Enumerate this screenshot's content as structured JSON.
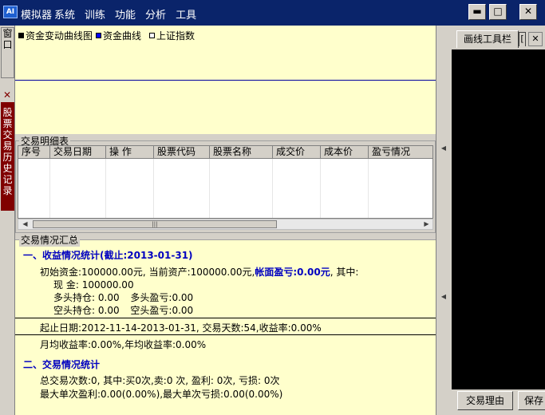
{
  "titlebar": {
    "app_icon": "AI",
    "title": "模拟器",
    "menu": [
      "系统",
      "训练",
      "功能",
      "分析",
      "工具"
    ],
    "buttons": {
      "minimize": "▬",
      "maximize": "□",
      "close": "✕"
    }
  },
  "left_tabs": {
    "window_tab": "窗口",
    "close_glyph": "✕",
    "history_tab": "股票交易历史记录"
  },
  "chart": {
    "legend": [
      {
        "label": "资金变动曲线图",
        "color": "#000000"
      },
      {
        "label": "资金曲线",
        "color": "#0000ff"
      },
      {
        "label": "上证指数",
        "color": "#ffffff"
      }
    ]
  },
  "transactions": {
    "title": "交易明细表",
    "columns": [
      "序号",
      "交易日期",
      "操 作",
      "股票代码",
      "股票名称",
      "成交价",
      "成本价",
      "盈亏情况"
    ],
    "rows": [],
    "scroll_left": "◀",
    "scroll_right": "▶",
    "scroll_thumb": "|||"
  },
  "summary": {
    "title": "交易情况汇总",
    "section1_title": "一、收益情况统计(截止:2013-01-31)",
    "initial_capital": "初始资金:100000.00元, 当前资产:100000.00元,",
    "book_pnl": "帐面盈亏:0.00元",
    "among": ", 其中:",
    "cash_label": "现    金:",
    "cash_value": "100000.00",
    "long_label": "多头持仓:",
    "long_value": "0.00",
    "long_pnl_label": "多头盈亏:",
    "long_pnl_value": "0.00",
    "short_label": "空头持仓:",
    "short_value": "0.00",
    "short_pnl_label": "空头盈亏:",
    "short_pnl_value": "0.00",
    "period": "起止日期:2012-11-14-2013-01-31, 交易天数:54,收益率:0.00%",
    "monthly": "月均收益率:0.00%,年均收益率:0.00%",
    "section2_title": "二、交易情况统计",
    "trades": "总交易次数:0, 其中:买0次,卖:0 次, 盈利: 0次, 亏损: 0次",
    "max_single": "最大单次盈利:0.00(0.00%),最大单次亏损:0.00(0.00%)"
  },
  "splitter": {
    "up": "◀",
    "down": "◀"
  },
  "right_panel": {
    "tab_label": "画线工具栏",
    "tab_small": "[",
    "tab_close": "✕",
    "reason_button": "交易理由",
    "save_button": "保存"
  }
}
